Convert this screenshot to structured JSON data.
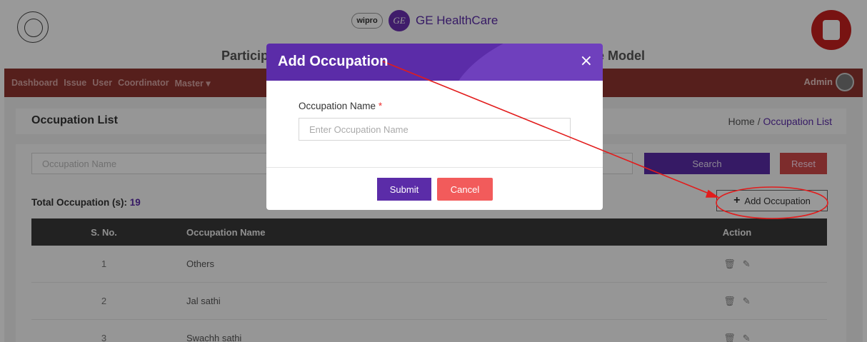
{
  "header": {
    "wipro": "wipro",
    "ge_mark": "GE",
    "ge_brand": "GE HealthCare",
    "title_left": "Particip",
    "title_right": "e Model"
  },
  "nav": {
    "items": [
      "Dashboard",
      "Issue",
      "User",
      "Coordinator",
      "Master ▾"
    ],
    "admin": "Admin"
  },
  "page": {
    "title": "Occupation List",
    "breadcrumb": {
      "home": "Home",
      "separator": "/",
      "current": "Occupation List"
    },
    "search_placeholder": "Occupation Name",
    "search_label": "Search",
    "reset_label": "Reset",
    "total_label": "Total Occupation (s):",
    "total_count": "19",
    "add_label": "Add Occupation",
    "table": {
      "headers": [
        "S. No.",
        "Occupation Name",
        "Action"
      ],
      "rows": [
        {
          "sno": "1",
          "name": "Others"
        },
        {
          "sno": "2",
          "name": "Jal sathi"
        },
        {
          "sno": "3",
          "name": "Swachh sathi"
        }
      ]
    }
  },
  "modal": {
    "title": "Add Occupation",
    "close": "×",
    "field_label": "Occupation Name",
    "required_mark": "*",
    "field_placeholder": "Enter Occupation Name",
    "submit": "Submit",
    "cancel": "Cancel"
  },
  "colors": {
    "accent": "#5b2ca8",
    "nav_bg": "#8f3430",
    "danger": "#f25b5b",
    "annotation": "#e21c1c"
  },
  "icons": {
    "delete": "trash-icon",
    "edit": "pencil-icon",
    "close": "close-icon",
    "add": "plus-icon"
  }
}
